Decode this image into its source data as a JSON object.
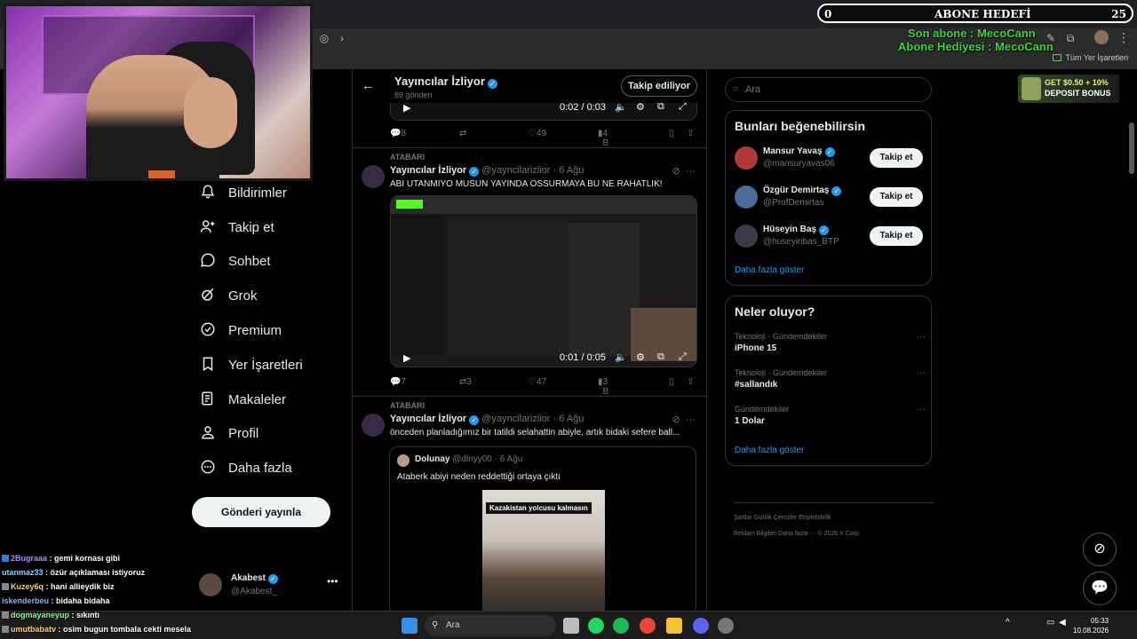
{
  "stream": {
    "abone_count_left": "0",
    "abone_title": "ABONE HEDEFİ",
    "abone_count_right": "25",
    "son_abone": "Son abone : MecoCann",
    "abone_hediyesi": "Abone Hediyesi : MecoCann"
  },
  "browser": {
    "bookmarks_right": "Tüm Yer İşaretleri"
  },
  "nav": {
    "items": [
      {
        "label": "Bildirimler"
      },
      {
        "label": "Takip et"
      },
      {
        "label": "Sohbet"
      },
      {
        "label": "Grok"
      },
      {
        "label": "Premium"
      },
      {
        "label": "Yer İşaretleri"
      },
      {
        "label": "Makaleler"
      },
      {
        "label": "Profil"
      },
      {
        "label": "Daha fazla"
      }
    ],
    "post_button": "Gönderi yayınla",
    "me": {
      "name": "Akabest",
      "handle": "@Akabest_"
    }
  },
  "timeline": {
    "title": "Yayıncılar İzliyor",
    "subtitle": "89 gönderi",
    "follow_label": "Takip ediliyor",
    "post0": {
      "video_time": "0:02 / 0:03",
      "replies": "8",
      "retweets": "",
      "likes": "49",
      "views": "4 B"
    },
    "post1": {
      "retweet_label": "ATABARI",
      "name": "Yayıncılar İzliyor",
      "handle": "@yayncilarizlior",
      "date": "6 Ağu",
      "text": "ABİ UTANMIYO MUSUN YAYINDA OSSURMAYA BU NE RAHATLIK!",
      "video_time": "0:01 / 0:05",
      "replies": "7",
      "retweets": "3",
      "likes": "47",
      "views": "3 B"
    },
    "post2": {
      "retweet_label": "ATABARI",
      "name": "Yayıncılar İzliyor",
      "handle": "@yayncilarizlior",
      "date": "6 Ağu",
      "text": "önceden planladığımız bir tatildi selahattin abiyle, artık bidaki sefere ball...",
      "quote": {
        "name": "Dolunay",
        "handle": "@dlnyy00",
        "date": "6 Ağu",
        "text": "Ataberk abiyi neden reddettiği ortaya çıktı",
        "image_caption": "Kazakistan yolcusu kalmasın"
      }
    }
  },
  "right": {
    "search_placeholder": "Ara",
    "ad_line1": "GET $0.50 + 10%",
    "ad_line2": "DEPOSIT BONUS",
    "wtf_title": "Bunları beğenebilirsin",
    "wtf": [
      {
        "name": "Mansur Yavaş",
        "handle": "@mansuryavas06",
        "button": "Takip et"
      },
      {
        "name": "Özgür Demirtaş",
        "handle": "@ProfDemirtas",
        "button": "Takip et"
      },
      {
        "name": "Hüseyin Baş",
        "handle": "@huseyinbas_BTP",
        "button": "Takip et"
      }
    ],
    "wtf_more": "Daha fazla göster",
    "trends_title": "Neler oluyor?",
    "trends": [
      {
        "context": "Teknoloji · Gündemdekiler",
        "name": "iPhone 15"
      },
      {
        "context": "Teknoloji · Gündemdekiler",
        "name": "#sallandık"
      },
      {
        "context": "Gündemdekiler",
        "name": "1 Dolar"
      }
    ],
    "trends_more": "Daha fazla göster",
    "footer1": "Şartlar   Gizlilik   Çerezler   Erişilebilirlik",
    "footer2": "Reklam Bilgileri   Daha fazla ···   © 2026 X Corp."
  },
  "chat": [
    {
      "user": "2Bugraaa",
      "color": "#b084ff",
      "msg": "gemi kornası gibi"
    },
    {
      "user": "utanmaz33",
      "color": "#7fd6ff",
      "msg": "özür açıklaması istiyoruz"
    },
    {
      "user": "Kuzey6q",
      "color": "#ffd34a",
      "msg": "hani allieydik biz"
    },
    {
      "user": "iskenderbeu",
      "color": "#7fb0ff",
      "msg": "bidaha bidaha"
    },
    {
      "user": "dogmayaneyup",
      "color": "#7fff7f",
      "msg": "sıkıntı"
    },
    {
      "user": "umutbabatv",
      "color": "#ffd34a",
      "msg": "osim bugun tombala cekti mesela"
    }
  ],
  "taskbar": {
    "search": "Ara",
    "time": "05:33",
    "date": "10.08.2026"
  }
}
